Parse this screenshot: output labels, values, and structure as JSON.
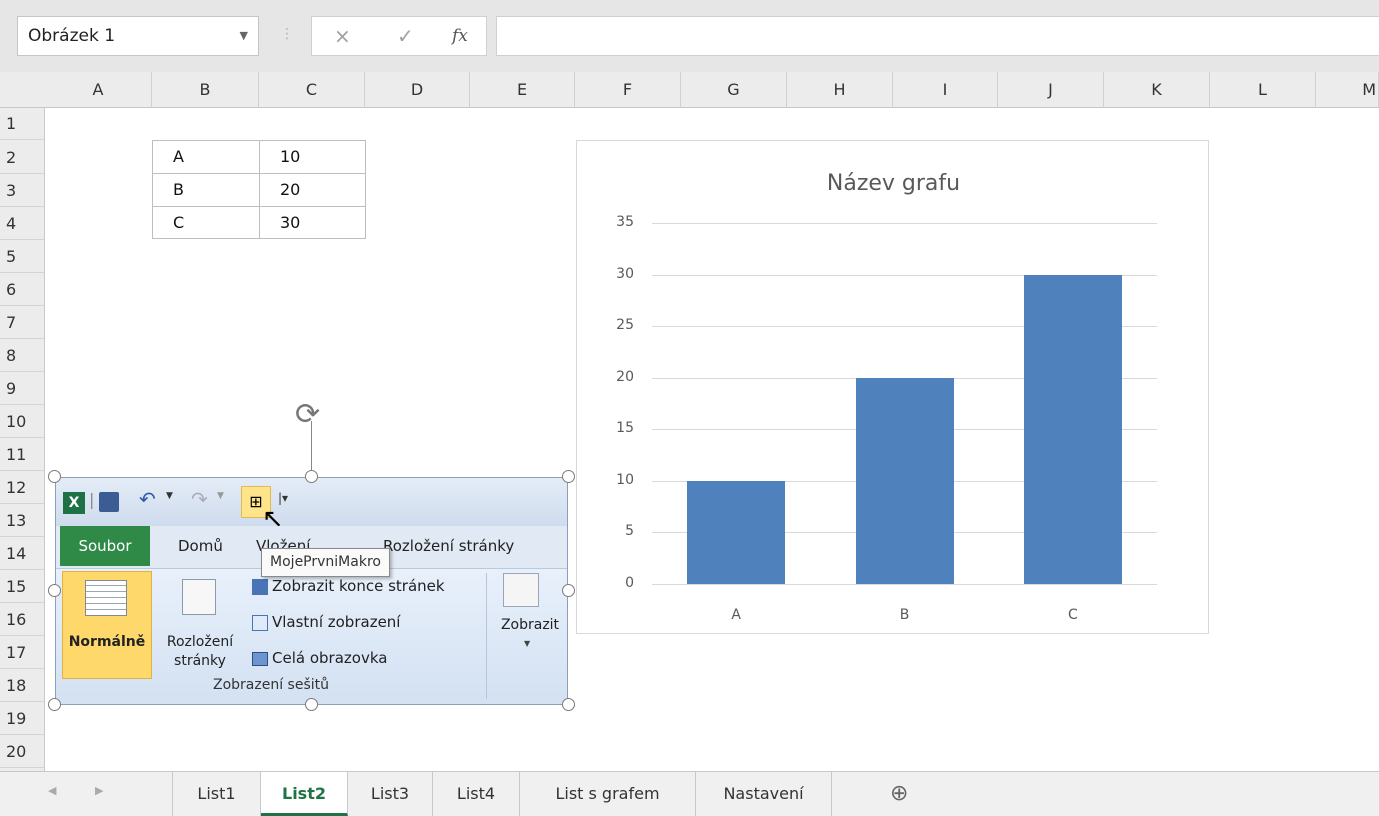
{
  "name_box": {
    "value": "Obrázek 1"
  },
  "formula_bar": {
    "cancel_icon": "×",
    "enter_icon": "✓",
    "fx_label": "fx",
    "value": ""
  },
  "columns": [
    "A",
    "B",
    "C",
    "D",
    "E",
    "F",
    "G",
    "H",
    "I",
    "J",
    "K",
    "L",
    "M"
  ],
  "rows": [
    "1",
    "2",
    "3",
    "4",
    "5",
    "6",
    "7",
    "8",
    "9",
    "10",
    "11",
    "12",
    "13",
    "14",
    "15",
    "16",
    "17",
    "18",
    "19",
    "20"
  ],
  "table": [
    [
      "A",
      "10"
    ],
    [
      "B",
      "20"
    ],
    [
      "C",
      "30"
    ]
  ],
  "chart_data": {
    "type": "bar",
    "title": "Název grafu",
    "categories": [
      "A",
      "B",
      "C"
    ],
    "values": [
      10,
      20,
      30
    ],
    "ylim": [
      0,
      35
    ],
    "yticks": [
      "0",
      "5",
      "10",
      "15",
      "20",
      "25",
      "30",
      "35"
    ],
    "xlabel": "",
    "ylabel": "",
    "grid": true,
    "bar_color": "#4f81bd"
  },
  "picture": {
    "qat_icons": [
      "excel-icon",
      "save-icon",
      "undo-icon",
      "redo-icon",
      "macro-icon",
      "customize-icon"
    ],
    "tabs": [
      "Soubor",
      "Domů",
      "Vložení",
      "Rozložení stránky"
    ],
    "normal_label": "Normálně",
    "layout_label": "Rozložení stránky",
    "page_breaks": "Zobrazit konce stránek",
    "custom_view": "Vlastní zobrazení",
    "full_screen": "Celá obrazovka",
    "group_label": "Zobrazení sešitů",
    "show_label": "Zobrazit"
  },
  "tooltip": "MojePrvniMakro",
  "sheet_tabs": [
    "List1",
    "List2",
    "List3",
    "List4",
    "List s grafem",
    "Nastavení"
  ],
  "active_sheet": "List2",
  "add_sheet_icon": "⊕",
  "nav_prev": "◀",
  "nav_next": "▶",
  "accent": "#217346"
}
